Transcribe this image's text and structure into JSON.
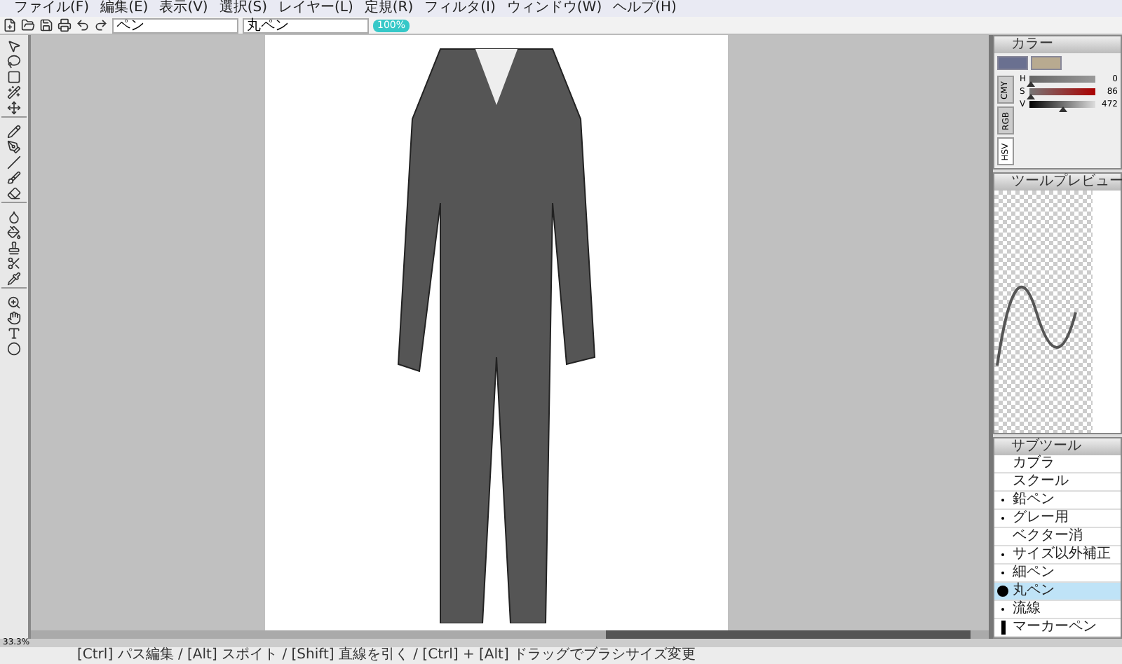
{
  "menu": [
    "ファイル(F)",
    "編集(E)",
    "表示(V)",
    "選択(S)",
    "レイヤー(L)",
    "定規(R)",
    "フィルタ(I)",
    "ウィンドウ(W)",
    "ヘルプ(H)"
  ],
  "toolbar": {
    "tool": "ペン",
    "brush": "丸ペン",
    "badge": "100%"
  },
  "color_panel": {
    "title": "カラー",
    "sliders": [
      {
        "label": "H",
        "level": 0.02,
        "reading": "0",
        "kind": "hue"
      },
      {
        "label": "S",
        "level": 0.02,
        "reading": "86",
        "kind": "sat"
      },
      {
        "label": "V",
        "level": 0.5,
        "reading": "472",
        "kind": "val"
      }
    ],
    "tabs": [
      {
        "label": "CMY",
        "selected": false
      },
      {
        "label": "RGB",
        "selected": false
      },
      {
        "label": "HSV",
        "selected": true
      }
    ]
  },
  "preview_panel": {
    "title": "ツールプレビュー"
  },
  "subtool_panel": {
    "title": "サブツール",
    "items": [
      {
        "label": "カブラ",
        "kind": "none",
        "selected": false
      },
      {
        "label": "スクール",
        "kind": "none",
        "selected": false
      },
      {
        "label": "鉛ペン",
        "kind": "small",
        "selected": false
      },
      {
        "label": "グレー用",
        "kind": "small",
        "selected": false
      },
      {
        "label": "ベクター消",
        "kind": "none",
        "selected": false
      },
      {
        "label": "サイズ以外補正",
        "kind": "small",
        "selected": false
      },
      {
        "label": "細ペン",
        "kind": "small",
        "selected": false
      },
      {
        "label": "丸ペン",
        "kind": "large",
        "selected": true
      },
      {
        "label": "流線",
        "kind": "small",
        "selected": false
      },
      {
        "label": "マーカーペン",
        "kind": "bar",
        "selected": false
      }
    ]
  },
  "zoom": "33.3%",
  "status_bar": "[Ctrl] パス編集 / [Alt] スポイト / [Shift] 直線を引く / [Ctrl] + [Alt] ドラッグでブラシサイズ変更"
}
